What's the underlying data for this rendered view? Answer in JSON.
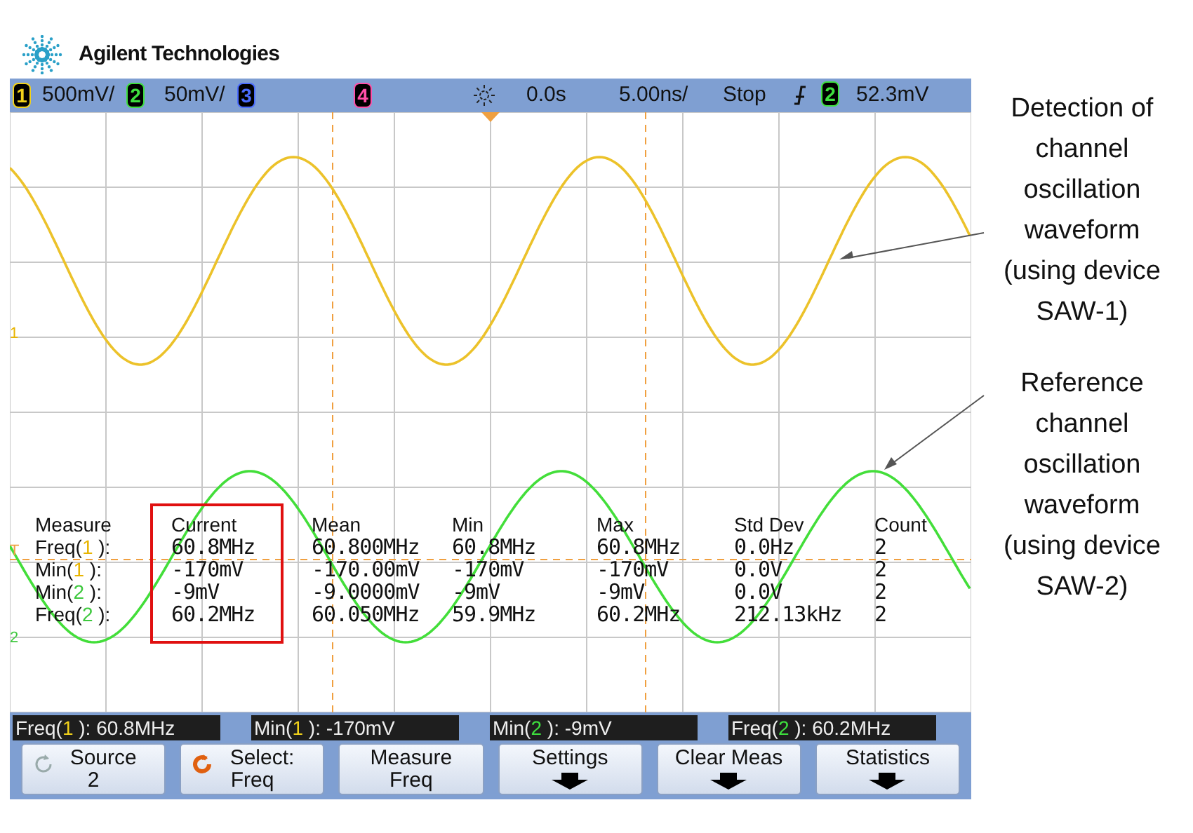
{
  "brand": {
    "name": "Agilent Technologies"
  },
  "top_bar": {
    "channels": [
      {
        "number": "1",
        "color": "#f2d21a",
        "scale": "500mV/"
      },
      {
        "number": "2",
        "color": "#3ee03e",
        "scale": "50mV/"
      },
      {
        "number": "3",
        "color": "#4a6cff"
      },
      {
        "number": "4",
        "color": "#ff4fa8"
      }
    ],
    "time_offset": "0.0s",
    "time_scale": "5.00ns/",
    "run_state": "Stop",
    "trigger": {
      "channel": "2",
      "color": "#3ee03e",
      "level": "52.3mV"
    }
  },
  "display": {
    "markers": [
      {
        "label": "1",
        "color": "#e8b400"
      },
      {
        "label": "T",
        "color": "#f0a040"
      },
      {
        "label": "2",
        "color": "#3ec83e"
      }
    ]
  },
  "measurements": {
    "columns": [
      {
        "label": "Measure",
        "highlighted": false
      },
      {
        "label": "Current",
        "highlighted": true
      },
      {
        "label": "Mean",
        "highlighted": false
      },
      {
        "label": "Min",
        "highlighted": false
      },
      {
        "label": "Max",
        "highlighted": false
      },
      {
        "label": "Std Dev",
        "highlighted": false
      },
      {
        "label": "Count",
        "highlighted": false
      }
    ],
    "rows": [
      {
        "function": "Freq(",
        "channel": "1",
        "suffix": " ):",
        "color": "#e8b400",
        "values": [
          "60.8MHz",
          "60.800MHz",
          "60.8MHz",
          "60.8MHz",
          "0.0Hz",
          "2"
        ]
      },
      {
        "function": "Min(",
        "channel": "1",
        "suffix": " ):",
        "color": "#e8b400",
        "values": [
          "-170mV",
          "-170.00mV",
          "-170mV",
          "-170mV",
          "0.0V",
          "2"
        ]
      },
      {
        "function": "Min(",
        "channel": "2",
        "suffix": " ):",
        "color": "#3ec83e",
        "values": [
          "-9mV",
          "-9.0000mV",
          "-9mV",
          "-9mV",
          "0.0V",
          "2"
        ]
      },
      {
        "function": "Freq(",
        "channel": "2",
        "suffix": " ):",
        "color": "#3ec83e",
        "values": [
          "60.2MHz",
          "60.050MHz",
          "59.9MHz",
          "60.2MHz",
          "212.13kHz",
          "2"
        ]
      }
    ]
  },
  "readouts": [
    {
      "function": "Freq(",
      "channel": "1",
      "suffix": " ):",
      "color": "#f2d21a",
      "value": "60.8MHz"
    },
    {
      "function": "Min(",
      "channel": "1",
      "suffix": " ):",
      "color": "#f2d21a",
      "value": "-170mV"
    },
    {
      "function": "Min(",
      "channel": "2",
      "suffix": " ):",
      "color": "#3ee03e",
      "value": "-9mV"
    },
    {
      "function": "Freq(",
      "channel": "2",
      "suffix": " ):",
      "color": "#3ee03e",
      "value": "60.2MHz"
    }
  ],
  "softkeys": [
    {
      "kind": "knob",
      "active": false,
      "line1": "Source",
      "line2": "2"
    },
    {
      "kind": "knob",
      "active": true,
      "line1": "Select:",
      "line2": "Freq"
    },
    {
      "kind": "plain",
      "line1": "Measure",
      "line2": "Freq"
    },
    {
      "kind": "menu",
      "line1": "Settings"
    },
    {
      "kind": "menu",
      "line1": "Clear Meas"
    },
    {
      "kind": "menu",
      "line1": "Statistics"
    }
  ],
  "annotations": [
    {
      "text": "Detection of channel oscillation waveform (using device SAW-1)"
    },
    {
      "text": "Reference channel oscillation waveform (using device SAW-2)"
    }
  ]
}
